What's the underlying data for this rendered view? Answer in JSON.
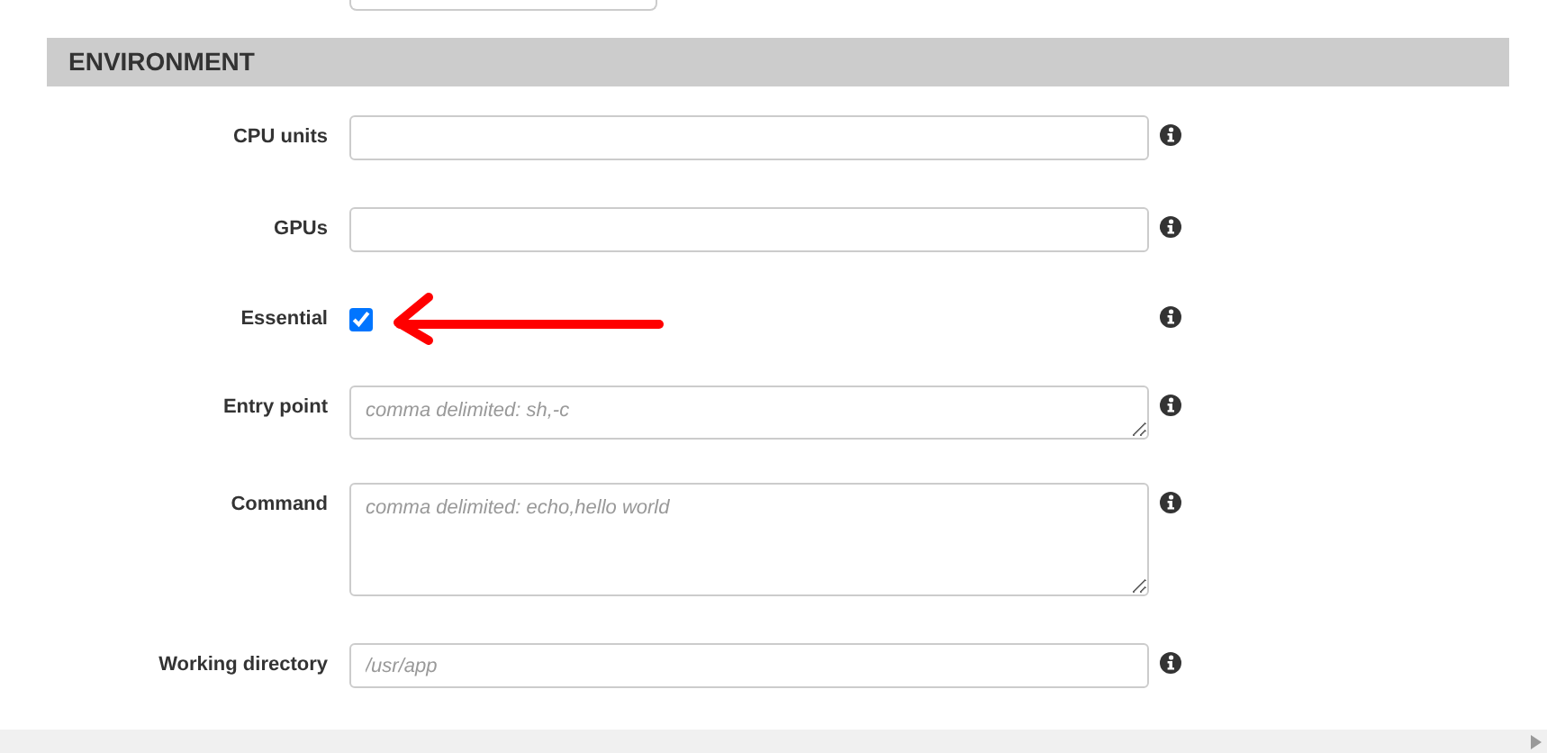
{
  "section": {
    "title": "ENVIRONMENT"
  },
  "fields": [
    {
      "kind": "input",
      "label": "CPU units"
    },
    {
      "kind": "input",
      "label": "GPUs"
    },
    {
      "kind": "checkbox",
      "label": "Essential",
      "checked": true
    },
    {
      "kind": "textarea",
      "label": "Entry point",
      "placeholder": "comma delimited: sh,-c"
    },
    {
      "kind": "textarea",
      "label": "Command",
      "placeholder": "comma delimited: echo,hello world"
    },
    {
      "kind": "input",
      "label": "Working directory",
      "placeholder": "/usr/app"
    }
  ]
}
